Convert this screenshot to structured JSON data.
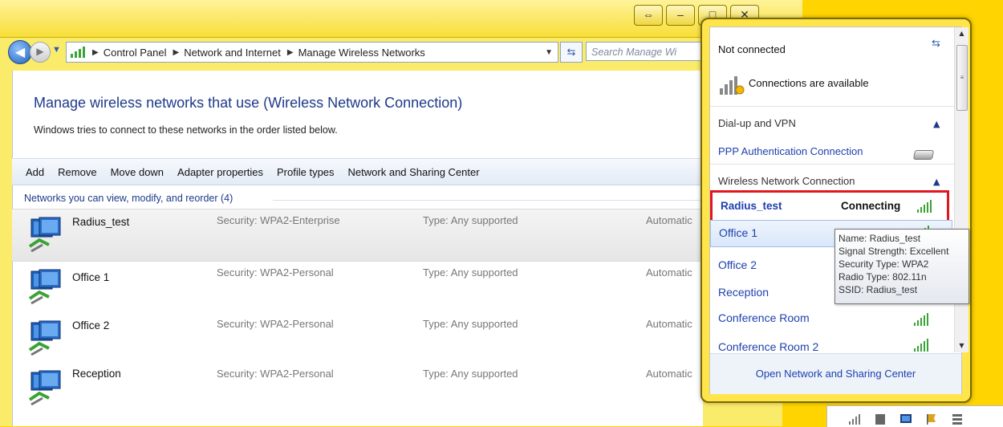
{
  "address_bar": {
    "crumbs": [
      "Control Panel",
      "Network and Internet",
      "Manage Wireless Networks"
    ],
    "search_placeholder": "Search Manage Wi"
  },
  "page": {
    "heading": "Manage wireless networks that use (Wireless Network Connection)",
    "subheading": "Windows tries to connect to these networks in the order listed below."
  },
  "toolbar": [
    "Add",
    "Remove",
    "Move down",
    "Adapter properties",
    "Profile types",
    "Network and Sharing Center"
  ],
  "group_header": "Networks you can view, modify, and reorder (4)",
  "networks": [
    {
      "name": "Radius_test",
      "security": "Security: WPA2-Enterprise",
      "type": "Type: Any supported",
      "mode": "Automatic"
    },
    {
      "name": "Office 1",
      "security": "Security: WPA2-Personal",
      "type": "Type: Any supported",
      "mode": "Automatic"
    },
    {
      "name": "Office 2",
      "security": "Security: WPA2-Personal",
      "type": "Type: Any supported",
      "mode": "Automatic"
    },
    {
      "name": "Reception",
      "security": "Security: WPA2-Personal",
      "type": "Type: Any supported",
      "mode": "Automatic"
    }
  ],
  "flyout": {
    "status": "Not connected",
    "available": "Connections are available",
    "section_dialup": "Dial-up and VPN",
    "ppp": "PPP Authentication Connection",
    "section_wireless": "Wireless Network Connection",
    "connecting_name": "Radius_test",
    "connecting_status": "Connecting",
    "wifi": [
      "Office 1",
      "Office 2",
      "Reception",
      "Conference Room",
      "Conference Room 2"
    ],
    "open_center": "Open Network and Sharing Center"
  },
  "tooltip": {
    "name": "Name: Radius_test",
    "signal": "Signal Strength: Excellent",
    "security": "Security Type: WPA2",
    "radio": "Radio Type: 802.11n",
    "ssid": "SSID: Radius_test"
  },
  "colors": {
    "accent_blue": "#1e40af",
    "highlight_red": "#e01620",
    "desktop_yellow": "#ffd400"
  }
}
